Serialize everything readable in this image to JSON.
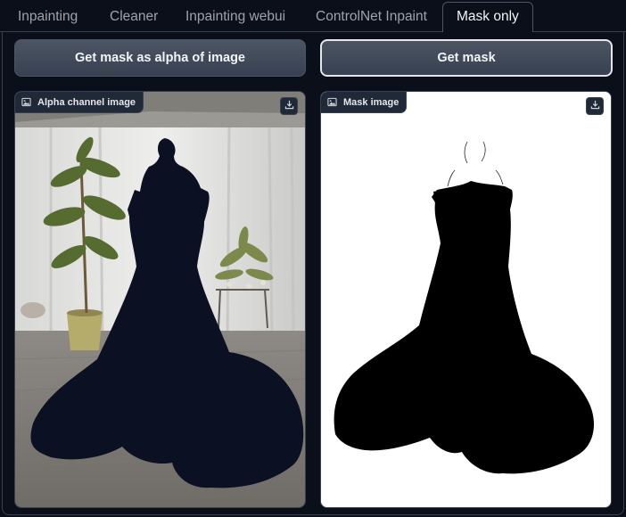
{
  "tabs": [
    {
      "label": "Inpainting",
      "active": false
    },
    {
      "label": "Cleaner",
      "active": false
    },
    {
      "label": "Inpainting webui",
      "active": false
    },
    {
      "label": "ControlNet Inpaint",
      "active": false
    },
    {
      "label": "Mask only",
      "active": true
    }
  ],
  "buttons": {
    "alpha_label": "Get mask as alpha of image",
    "mask_label": "Get mask"
  },
  "panels": {
    "alpha": {
      "label": "Alpha channel image",
      "icon": "image-icon",
      "download_icon": "download-icon"
    },
    "mask": {
      "label": "Mask image",
      "icon": "image-icon",
      "download_icon": "download-icon"
    }
  },
  "colors": {
    "background": "#0b0f19",
    "panel_label_bg": "#1f2937",
    "border": "#374151",
    "button_bg": "#4b5563",
    "masked_dress": "#0b1022",
    "mask_fg": "#000000",
    "mask_bg": "#ffffff"
  }
}
